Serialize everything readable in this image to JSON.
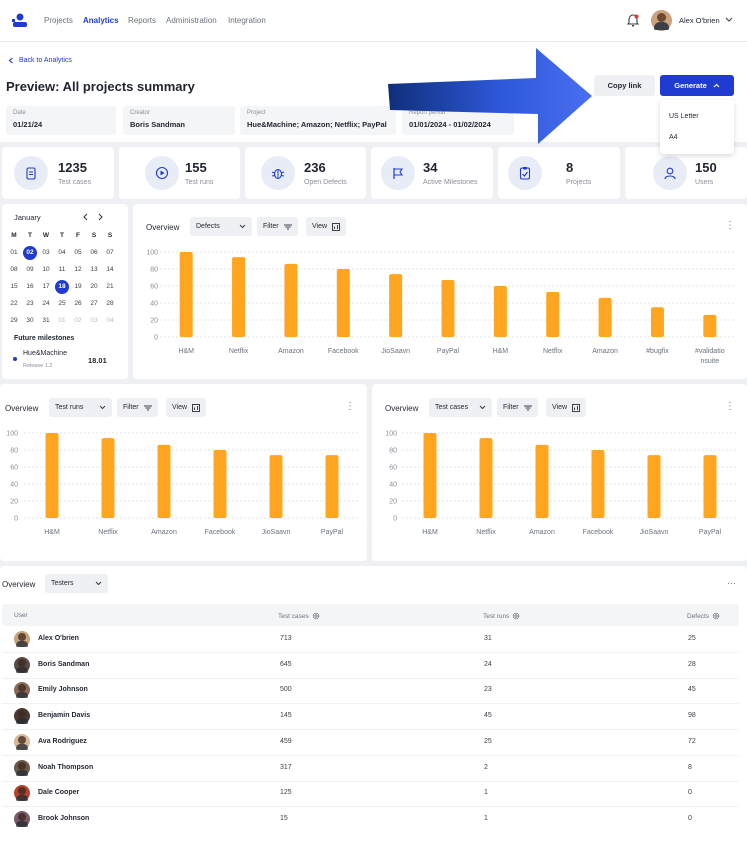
{
  "nav": {
    "links": [
      "Projects",
      "Analytics",
      "Reports",
      "Administration",
      "Integration"
    ],
    "user_name": "Alex O'brien"
  },
  "header": {
    "back_label": "Back to Analytics",
    "title": "Preview: All projects summary",
    "copy_link_label": "Copy link",
    "generate_label": "Generate",
    "generate_options": [
      "US Letter",
      "A4"
    ],
    "meta": [
      {
        "label": "Date",
        "value": "01/21/24"
      },
      {
        "label": "Creator",
        "value": "Boris Sandman"
      },
      {
        "label": "Project",
        "value": "Hue&Machine; Amazon; Netflix; PayPal"
      },
      {
        "label": "Report period",
        "value": "01/01/2024 - 01/02/2024"
      }
    ]
  },
  "stats": [
    {
      "value": "1235",
      "label": "Test cases",
      "icon": "document-icon"
    },
    {
      "value": "155",
      "label": "Test runs",
      "icon": "play-icon"
    },
    {
      "value": "236",
      "label": "Open Defects",
      "icon": "bug-icon"
    },
    {
      "value": "34",
      "label": "Active Milestones",
      "icon": "flag-icon"
    },
    {
      "value": "8",
      "label": "Projects",
      "icon": "clipboard-icon"
    },
    {
      "value": "150",
      "label": "Users",
      "icon": "user-icon"
    }
  ],
  "calendar": {
    "month": "January",
    "weekdays": [
      "M",
      "T",
      "W",
      "T",
      "F",
      "S",
      "S"
    ],
    "weeks": [
      [
        "01",
        "02",
        "03",
        "04",
        "05",
        "06",
        "07"
      ],
      [
        "08",
        "09",
        "10",
        "11",
        "12",
        "13",
        "14"
      ],
      [
        "15",
        "16",
        "17",
        "18",
        "19",
        "20",
        "21"
      ],
      [
        "22",
        "23",
        "24",
        "25",
        "26",
        "27",
        "28"
      ],
      [
        "29",
        "30",
        "31",
        "01",
        "02",
        "03",
        "04"
      ]
    ],
    "selected": [
      "02",
      "18"
    ],
    "future_milestones_label": "Future milestones",
    "milestone": {
      "name": "Hue&Machine",
      "sub": "Release 1.2",
      "date": "18.01"
    }
  },
  "controls": {
    "overview_label": "Overview",
    "filter_label": "Filter",
    "view_label": "View",
    "defects_label": "Defects",
    "test_runs_label": "Test runs",
    "test_cases_label": "Test cases",
    "testers_label": "Testers"
  },
  "colors": {
    "accent": "#1f3bd1",
    "bar": "#ffa51f",
    "arrow": "#3a5fe0"
  },
  "chart_data": [
    {
      "type": "bar",
      "title": "",
      "categories": [
        "H&M",
        "Netflix",
        "Amazon",
        "Facebook",
        "JioSaavn",
        "PayPal",
        "H&M",
        "Netflix",
        "Amazon",
        "#bugfix",
        "#validationsuite"
      ],
      "category_lines": [
        [
          "H&M"
        ],
        [
          "Netflix"
        ],
        [
          "Amazon"
        ],
        [
          "Facebook"
        ],
        [
          "JioSaavn"
        ],
        [
          "PayPal"
        ],
        [
          "H&M"
        ],
        [
          "Netflix"
        ],
        [
          "Amazon"
        ],
        [
          "#bugfix"
        ],
        [
          "#validatio",
          "nsuite"
        ]
      ],
      "values": [
        100,
        94,
        86,
        80,
        74,
        67,
        60,
        53,
        46,
        35,
        26
      ],
      "yticks": [
        0,
        20,
        40,
        60,
        80,
        100
      ],
      "ylim": [
        0,
        100
      ],
      "grid": true
    },
    {
      "type": "bar",
      "title": "",
      "categories": [
        "H&M",
        "Netflix",
        "Amazon",
        "Facebook",
        "JioSaavn",
        "PayPal"
      ],
      "values": [
        100,
        94,
        86,
        80,
        74,
        74
      ],
      "yticks": [
        0,
        20,
        40,
        60,
        80,
        100
      ],
      "ylim": [
        0,
        100
      ],
      "grid": true
    },
    {
      "type": "bar",
      "title": "",
      "categories": [
        "H&M",
        "Netflix",
        "Amazon",
        "Facebook",
        "JioSaavn",
        "PayPal"
      ],
      "values": [
        100,
        94,
        86,
        80,
        74,
        74
      ],
      "yticks": [
        0,
        20,
        40,
        60,
        80,
        100
      ],
      "ylim": [
        0,
        100
      ],
      "grid": true
    }
  ],
  "table": {
    "columns": [
      "User",
      "Test cases",
      "Test runs",
      "Defects"
    ],
    "rows": [
      {
        "name": "Alex O'brien",
        "cases": "713",
        "runs": "31",
        "defects": "25",
        "avatar_color": "#c9a27e"
      },
      {
        "name": "Boris Sandman",
        "cases": "645",
        "runs": "24",
        "defects": "28",
        "avatar_color": "#5a4a42"
      },
      {
        "name": "Emily Johnson",
        "cases": "500",
        "runs": "23",
        "defects": "45",
        "avatar_color": "#8a6a55"
      },
      {
        "name": "Benjamin Davis",
        "cases": "145",
        "runs": "45",
        "defects": "98",
        "avatar_color": "#4a3a30"
      },
      {
        "name": "Ava Rodriguez",
        "cases": "459",
        "runs": "25",
        "defects": "72",
        "avatar_color": "#d8b896"
      },
      {
        "name": "Noah Thompson",
        "cases": "317",
        "runs": "2",
        "defects": "8",
        "avatar_color": "#6b5a4a"
      },
      {
        "name": "Dale Cooper",
        "cases": "125",
        "runs": "1",
        "defects": "0",
        "avatar_color": "#b5432f"
      },
      {
        "name": "Brook Johnson",
        "cases": "15",
        "runs": "1",
        "defects": "0",
        "avatar_color": "#7a5a6a"
      }
    ]
  }
}
